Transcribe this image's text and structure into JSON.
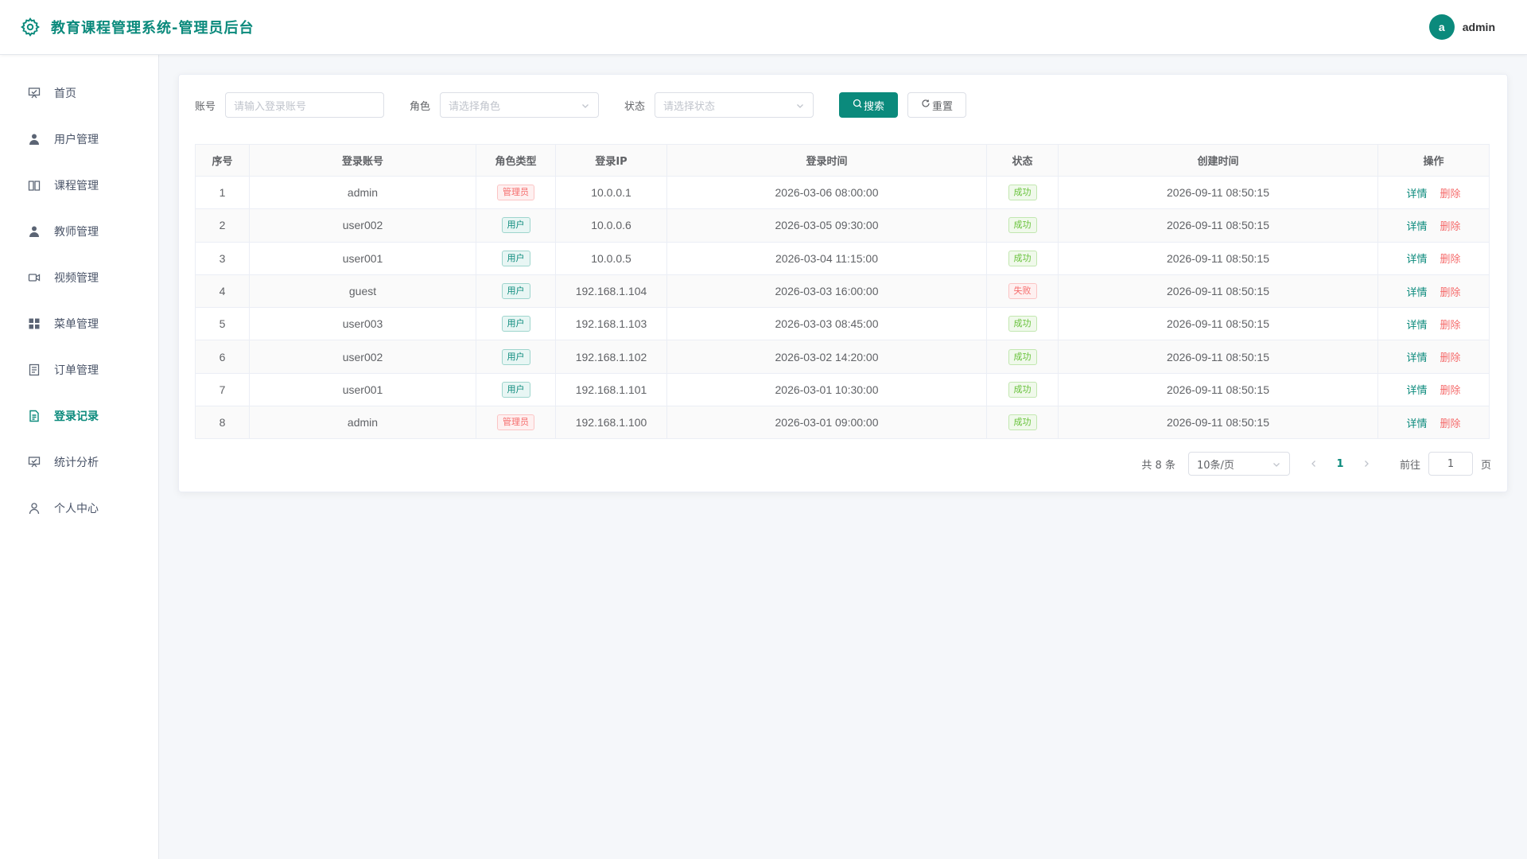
{
  "header": {
    "title": "教育课程管理系统-管理员后台",
    "avatar_letter": "a",
    "username": "admin"
  },
  "sidebar": {
    "items": [
      {
        "label": "首页",
        "icon": "presentation-icon"
      },
      {
        "label": "用户管理",
        "icon": "user-icon"
      },
      {
        "label": "课程管理",
        "icon": "book-icon"
      },
      {
        "label": "教师管理",
        "icon": "user-icon"
      },
      {
        "label": "视频管理",
        "icon": "video-camera-icon"
      },
      {
        "label": "菜单管理",
        "icon": "grid-icon"
      },
      {
        "label": "订单管理",
        "icon": "tickets-icon"
      },
      {
        "label": "登录记录",
        "icon": "document-icon",
        "active": true
      },
      {
        "label": "统计分析",
        "icon": "presentation-icon"
      },
      {
        "label": "个人中心",
        "icon": "user-outline-icon"
      }
    ]
  },
  "filter": {
    "account_label": "账号",
    "account_placeholder": "请输入登录账号",
    "role_label": "角色",
    "role_placeholder": "请选择角色",
    "status_label": "状态",
    "status_placeholder": "请选择状态",
    "search_label": "搜索",
    "reset_label": "重置"
  },
  "table": {
    "headers": [
      "序号",
      "登录账号",
      "角色类型",
      "登录IP",
      "登录时间",
      "状态",
      "创建时间",
      "操作"
    ],
    "detail_label": "详情",
    "delete_label": "删除",
    "rows": [
      {
        "no": "1",
        "account": "admin",
        "role": "管理员",
        "ip": "10.0.0.1",
        "login_time": "2026-03-06 08:00:00",
        "status": "成功",
        "created": "2026-09-11 08:50:15"
      },
      {
        "no": "2",
        "account": "user002",
        "role": "用户",
        "ip": "10.0.0.6",
        "login_time": "2026-03-05 09:30:00",
        "status": "成功",
        "created": "2026-09-11 08:50:15"
      },
      {
        "no": "3",
        "account": "user001",
        "role": "用户",
        "ip": "10.0.0.5",
        "login_time": "2026-03-04 11:15:00",
        "status": "成功",
        "created": "2026-09-11 08:50:15"
      },
      {
        "no": "4",
        "account": "guest",
        "role": "用户",
        "ip": "192.168.1.104",
        "login_time": "2026-03-03 16:00:00",
        "status": "失败",
        "created": "2026-09-11 08:50:15"
      },
      {
        "no": "5",
        "account": "user003",
        "role": "用户",
        "ip": "192.168.1.103",
        "login_time": "2026-03-03 08:45:00",
        "status": "成功",
        "created": "2026-09-11 08:50:15"
      },
      {
        "no": "6",
        "account": "user002",
        "role": "用户",
        "ip": "192.168.1.102",
        "login_time": "2026-03-02 14:20:00",
        "status": "成功",
        "created": "2026-09-11 08:50:15"
      },
      {
        "no": "7",
        "account": "user001",
        "role": "用户",
        "ip": "192.168.1.101",
        "login_time": "2026-03-01 10:30:00",
        "status": "成功",
        "created": "2026-09-11 08:50:15"
      },
      {
        "no": "8",
        "account": "admin",
        "role": "管理员",
        "ip": "192.168.1.100",
        "login_time": "2026-03-01 09:00:00",
        "status": "成功",
        "created": "2026-09-11 08:50:15"
      }
    ]
  },
  "pagination": {
    "total_text": "共 8 条",
    "page_size": "10条/页",
    "current_page": "1",
    "goto_label": "前往",
    "goto_value": "1",
    "page_unit": "页"
  },
  "colors": {
    "primary": "#0b8a7c",
    "danger": "#f56c6c",
    "success": "#67c23a"
  }
}
